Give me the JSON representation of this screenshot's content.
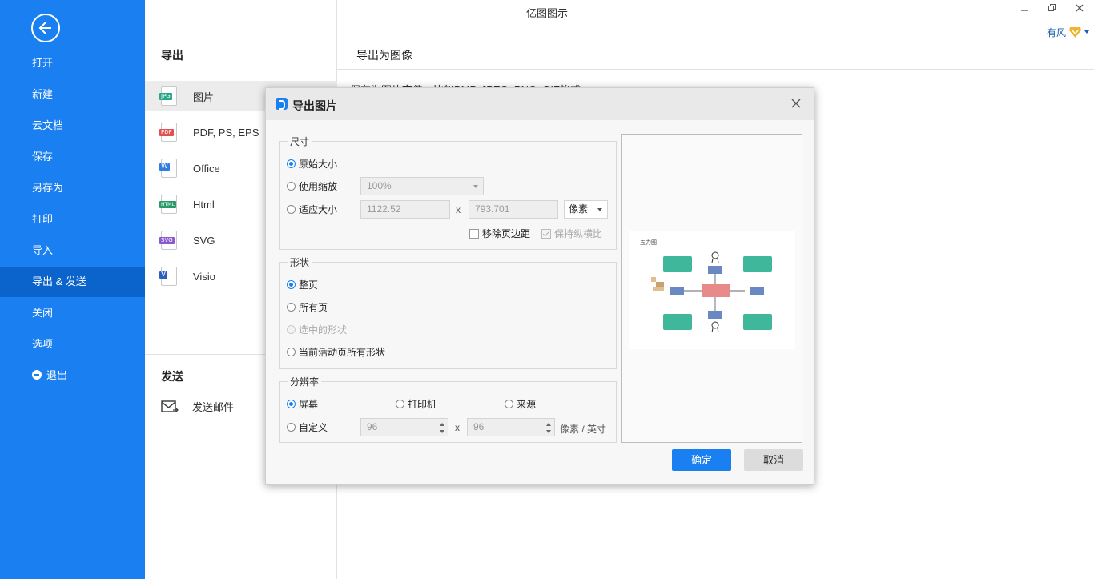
{
  "app": {
    "title": "亿图图示",
    "user": "有风"
  },
  "nav": {
    "items": [
      "打开",
      "新建",
      "云文档",
      "保存",
      "另存为",
      "打印",
      "导入",
      "导出 & 发送",
      "关闭",
      "选项",
      "退出"
    ]
  },
  "export": {
    "title": "导出",
    "formats": [
      "图片",
      "PDF, PS, EPS",
      "Office",
      "Html",
      "SVG",
      "Visio"
    ],
    "format_badges": [
      "JPG",
      "PDF",
      "W",
      "HTML",
      "SVG",
      "V"
    ],
    "send_title": "发送",
    "send_mail": "发送邮件"
  },
  "right": {
    "title": "导出为图像",
    "desc": "保存为图片文件，比如BMP, JPEG, PNG, GIF格式。"
  },
  "dialog": {
    "title": "导出图片",
    "size": {
      "legend": "尺寸",
      "original": "原始大小",
      "use_zoom": "使用缩放",
      "zoom_value": "100%",
      "fit": "适应大小",
      "width": "1122.52",
      "height": "793.701",
      "x_sep": "x",
      "unit": "像素",
      "remove_margin": "移除页边距",
      "keep_ratio": "保持纵横比"
    },
    "shape": {
      "legend": "形状",
      "whole_page": "整页",
      "all_pages": "所有页",
      "selected": "选中的形状",
      "current_all": "当前活动页所有形状"
    },
    "resolution": {
      "legend": "分辨率",
      "screen": "屏幕",
      "printer": "打印机",
      "source": "来源",
      "custom": "自定义",
      "dpi_x": "96",
      "dpi_y": "96",
      "x_sep": "x",
      "unit": "像素 / 英寸"
    },
    "preview": {
      "diagram_title": "五力图"
    },
    "ok": "确定",
    "cancel": "取消"
  },
  "colors": {
    "nav_bg": "#1a7ff0",
    "nav_active": "#0b64cc",
    "accent": "#1a7ff0",
    "teal_box": "#3fb79a",
    "red_box": "#e98a8a",
    "blue_box": "#6a88c4"
  }
}
